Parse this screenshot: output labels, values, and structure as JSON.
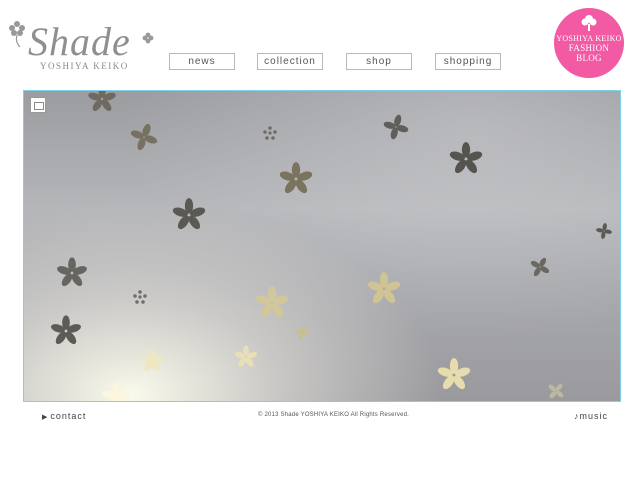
{
  "logo": {
    "wordmark": "Shade",
    "subtitle": "YOSHIYA KEIKO",
    "icons": [
      "flower-icon",
      "flower-icon"
    ]
  },
  "nav": {
    "items": [
      {
        "label": "news"
      },
      {
        "label": "collection"
      },
      {
        "label": "shop"
      },
      {
        "label": "shopping"
      }
    ]
  },
  "blog_badge": {
    "line1": "YOSHIYA KEIKO",
    "line2": "FASHION",
    "line3": "BLOG",
    "color": "#f25aa4",
    "icon": "tree-icon"
  },
  "photo": {
    "description_icon": "image-thumbnail-icon",
    "border_color": "#7fd1ea"
  },
  "footer": {
    "contact": "contact",
    "copyright": "© 2013 Shade YOSHIYA KEIKO All Rights Reserved.",
    "music": "music",
    "contact_icon": "triangle-right-icon",
    "music_icon": "music-note-icon"
  }
}
